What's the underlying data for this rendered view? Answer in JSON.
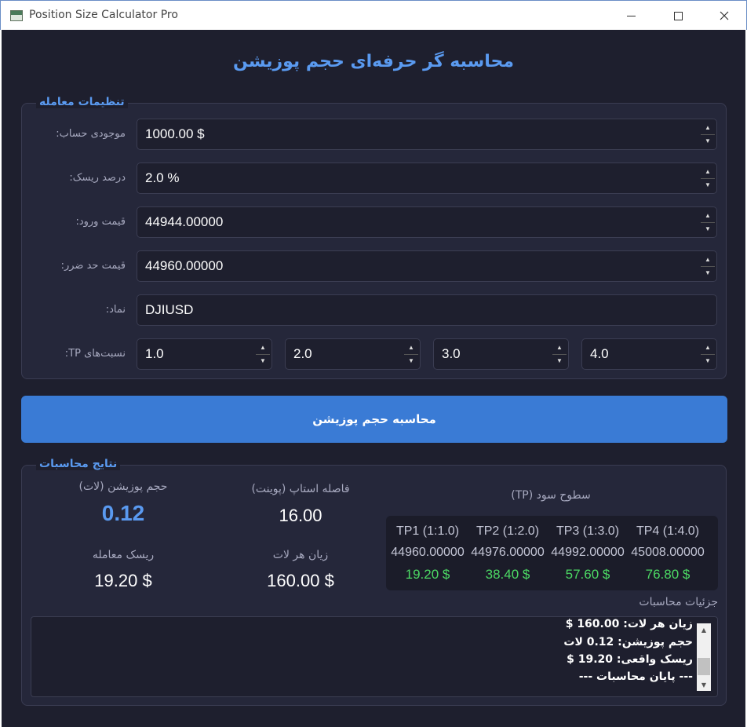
{
  "window": {
    "title": "Position Size Calculator Pro"
  },
  "header": {
    "title": "محاسبه گر حرفه‌ای حجم پوزیشن"
  },
  "settings": {
    "title": "تنظیمات معامله",
    "balance": {
      "label": "موجودی حساب:",
      "value": "1000.00 $"
    },
    "risk_percent": {
      "label": "درصد ریسک:",
      "value": "2.0 %"
    },
    "entry_price": {
      "label": "قیمت ورود:",
      "value": "44944.00000"
    },
    "stop_loss": {
      "label": "قیمت حد ضرر:",
      "value": "44960.00000"
    },
    "symbol": {
      "label": "نماد:",
      "value": "DJIUSD"
    },
    "tp_ratios": {
      "label": "نسبت‌های TP:",
      "values": [
        "1.0",
        "2.0",
        "3.0",
        "4.0"
      ]
    }
  },
  "calculate_button": "محاسبه حجم پوزیشن",
  "results": {
    "title": "نتایج محاسبات",
    "position_size": {
      "label": "حجم پوزیشن (لات)",
      "value": "0.12"
    },
    "stop_distance": {
      "label": "فاصله استاپ (پوینت)",
      "value": "16.00"
    },
    "trade_risk": {
      "label": "ریسک معامله",
      "value": "19.20 $"
    },
    "loss_per_lot": {
      "label": "زیان هر لات",
      "value": "160.00 $"
    },
    "tp_levels": {
      "title": "سطوح سود (TP)",
      "items": [
        {
          "label": "TP1 (1:1.0)",
          "price": "44960.00000",
          "profit": "19.20 $"
        },
        {
          "label": "TP2 (1:2.0)",
          "price": "44976.00000",
          "profit": "38.40 $"
        },
        {
          "label": "TP3 (1:3.0)",
          "price": "44992.00000",
          "profit": "57.60 $"
        },
        {
          "label": "TP4 (1:4.0)",
          "price": "45008.00000",
          "profit": "76.80 $"
        }
      ]
    },
    "details": {
      "label": "جزئیات محاسبات",
      "lines": [
        "زیان هر لات: 160.00 $",
        "حجم پوزیشن: 0.12 لات",
        "ریسک واقعی: 19.20 $",
        "--- پایان محاسبات ---"
      ]
    }
  }
}
